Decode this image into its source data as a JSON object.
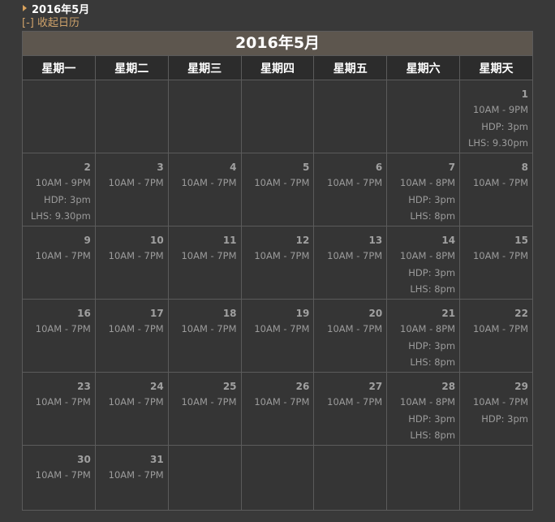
{
  "header": {
    "month_title": "2016年5月",
    "collapse_label": "[-] 收起日历"
  },
  "calendar": {
    "title": "2016年5月",
    "weekdays": [
      "星期一",
      "星期二",
      "星期三",
      "星期四",
      "星期五",
      "星期六",
      "星期天"
    ],
    "weeks": [
      [
        null,
        null,
        null,
        null,
        null,
        null,
        {
          "day": "1",
          "events": [
            "10AM - 9PM",
            "HDP: 3pm",
            "LHS: 9.30pm"
          ]
        }
      ],
      [
        {
          "day": "2",
          "events": [
            "10AM - 9PM",
            "HDP: 3pm",
            "LHS: 9.30pm"
          ]
        },
        {
          "day": "3",
          "events": [
            "10AM - 7PM"
          ]
        },
        {
          "day": "4",
          "events": [
            "10AM - 7PM"
          ]
        },
        {
          "day": "5",
          "events": [
            "10AM - 7PM"
          ]
        },
        {
          "day": "6",
          "events": [
            "10AM - 7PM"
          ]
        },
        {
          "day": "7",
          "events": [
            "10AM - 8PM",
            "HDP: 3pm",
            "LHS: 8pm"
          ]
        },
        {
          "day": "8",
          "events": [
            "10AM - 7PM"
          ]
        }
      ],
      [
        {
          "day": "9",
          "events": [
            "10AM - 7PM"
          ]
        },
        {
          "day": "10",
          "events": [
            "10AM - 7PM"
          ]
        },
        {
          "day": "11",
          "events": [
            "10AM - 7PM"
          ]
        },
        {
          "day": "12",
          "events": [
            "10AM - 7PM"
          ]
        },
        {
          "day": "13",
          "events": [
            "10AM - 7PM"
          ]
        },
        {
          "day": "14",
          "events": [
            "10AM - 8PM",
            "HDP: 3pm",
            "LHS: 8pm"
          ]
        },
        {
          "day": "15",
          "events": [
            "10AM - 7PM"
          ]
        }
      ],
      [
        {
          "day": "16",
          "events": [
            "10AM - 7PM"
          ]
        },
        {
          "day": "17",
          "events": [
            "10AM - 7PM"
          ]
        },
        {
          "day": "18",
          "events": [
            "10AM - 7PM"
          ]
        },
        {
          "day": "19",
          "events": [
            "10AM - 7PM"
          ]
        },
        {
          "day": "20",
          "events": [
            "10AM - 7PM"
          ]
        },
        {
          "day": "21",
          "events": [
            "10AM - 8PM",
            "HDP: 3pm",
            "LHS: 8pm"
          ]
        },
        {
          "day": "22",
          "events": [
            "10AM - 7PM"
          ]
        }
      ],
      [
        {
          "day": "23",
          "events": [
            "10AM - 7PM"
          ]
        },
        {
          "day": "24",
          "events": [
            "10AM - 7PM"
          ]
        },
        {
          "day": "25",
          "events": [
            "10AM - 7PM"
          ]
        },
        {
          "day": "26",
          "events": [
            "10AM - 7PM"
          ]
        },
        {
          "day": "27",
          "events": [
            "10AM - 7PM"
          ]
        },
        {
          "day": "28",
          "events": [
            "10AM - 8PM",
            "HDP: 3pm",
            "LHS: 8pm"
          ]
        },
        {
          "day": "29",
          "events": [
            "10AM - 7PM",
            "HDP: 3pm"
          ]
        }
      ],
      [
        {
          "day": "30",
          "events": [
            "10AM - 7PM"
          ]
        },
        {
          "day": "31",
          "events": [
            "10AM - 7PM"
          ]
        },
        null,
        null,
        null,
        null,
        null
      ]
    ]
  },
  "colors": {
    "page_bg": "#393939",
    "title_bar_bg": "#5d564e",
    "header_bg": "#2c2c2c",
    "cell_bg": "#353535",
    "border": "#5b5b5b",
    "text_muted": "#9b9b9b",
    "link_accent": "#cfa26a"
  }
}
